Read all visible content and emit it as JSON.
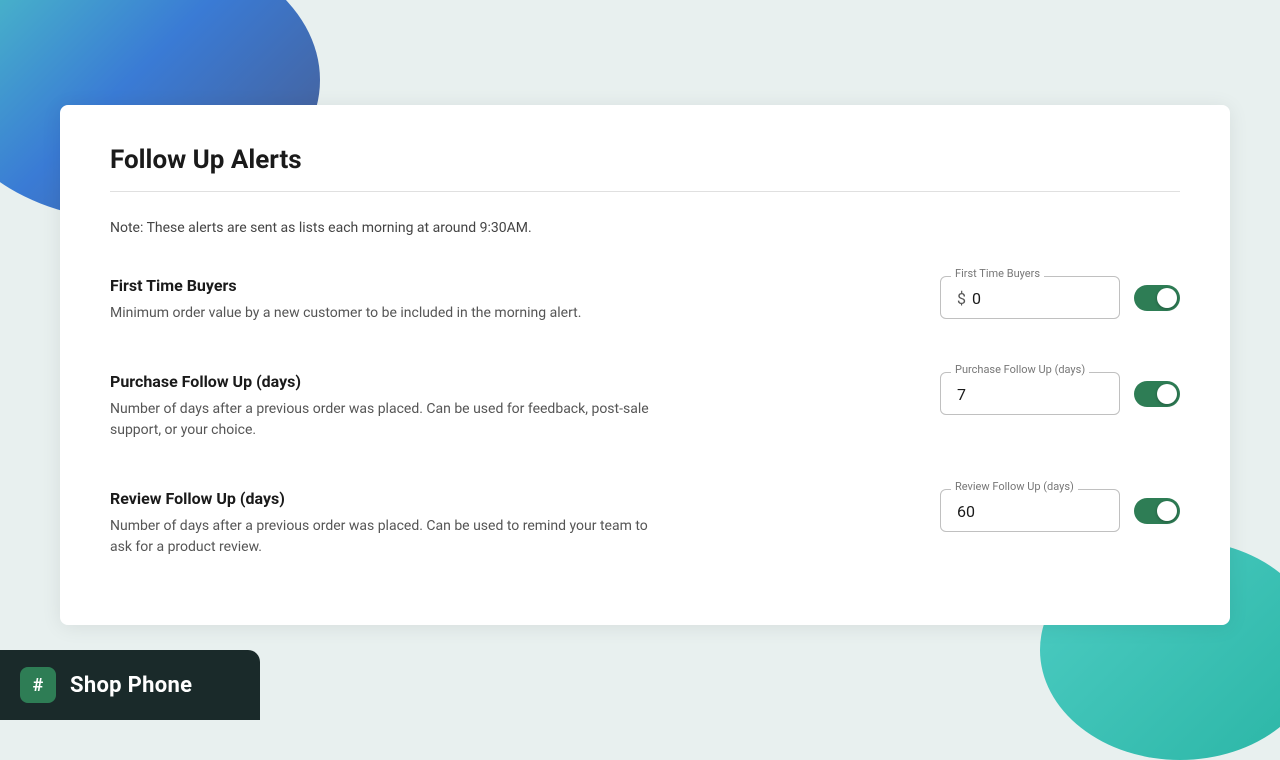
{
  "background": {
    "colors": {
      "topLeft": "#4ecdc4",
      "bottomRight": "#4ecdc4"
    }
  },
  "branding": {
    "app_name": "Shop Phone",
    "icon_symbol": "#"
  },
  "page": {
    "title": "Follow Up Alerts",
    "note": "Note: These alerts are sent as lists each morning at around 9:30AM.",
    "divider": true
  },
  "alerts": [
    {
      "id": "first-time-buyers",
      "title": "First Time Buyers",
      "subtitle": "Minimum order value by a new customer to be included in the morning alert.",
      "field_label": "First Time Buyers",
      "field_prefix": "$",
      "field_value": "0",
      "toggle_enabled": true
    },
    {
      "id": "purchase-follow-up",
      "title": "Purchase Follow Up (days)",
      "subtitle": "Number of days after a previous order was placed. Can be used for feedback, post-sale support, or your choice.",
      "field_label": "Purchase Follow Up (days)",
      "field_prefix": "",
      "field_value": "7",
      "toggle_enabled": true
    },
    {
      "id": "review-follow-up",
      "title": "Review Follow Up (days)",
      "subtitle": "Number of days after a previous order was placed. Can be used to remind your team to ask for a product review.",
      "field_label": "Review Follow Up (days)",
      "field_prefix": "",
      "field_value": "60",
      "toggle_enabled": true
    }
  ]
}
